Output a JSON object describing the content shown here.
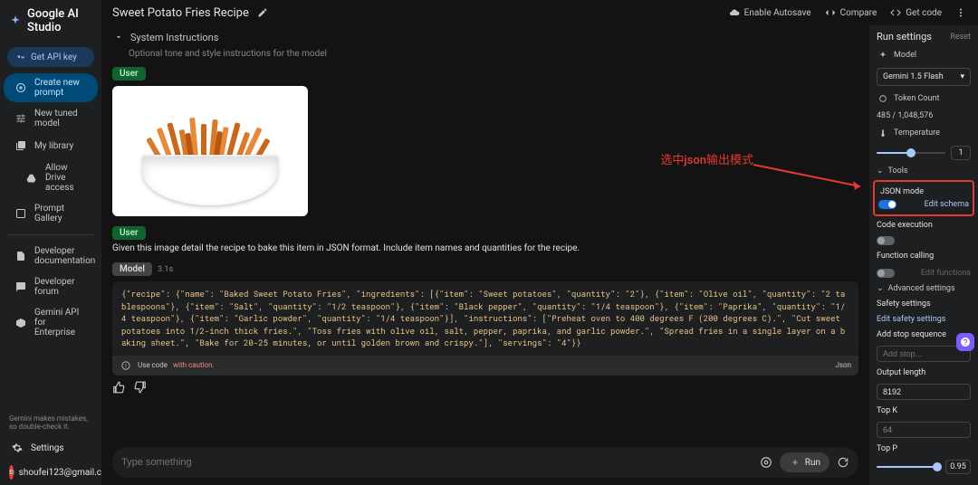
{
  "logo": "Google AI Studio",
  "api_btn": "Get API key",
  "nav": {
    "new_prompt": "Create new prompt",
    "new_tuned": "New tuned model",
    "my_library": "My library",
    "drive": "Allow Drive access",
    "gallery": "Prompt Gallery",
    "docs": "Developer documentation",
    "forum": "Developer forum",
    "enterprise": "Gemini API for Enterprise"
  },
  "disclaimer": "Gemini makes mistakes, so double-check it.",
  "settings_label": "Settings",
  "user_email": "shoufei123@gmail.com",
  "title": "Sweet Potato Fries Recipe",
  "top": {
    "autosave": "Enable Autosave",
    "compare": "Compare",
    "getcode": "Get code"
  },
  "sysinst": {
    "label": "System Instructions",
    "hint": "Optional tone and style instructions for the model"
  },
  "roles": {
    "user": "User",
    "model": "Model"
  },
  "user_prompt": "Given this image detail the recipe to bake this item in JSON format. Include item names and quantities for the recipe.",
  "model_time": "3.1s",
  "code_output": "{\"recipe\": {\"name\": \"Baked Sweet Potato Fries\", \"ingredients\": [{\"item\": \"Sweet potatoes\", \"quantity\": \"2\"}, {\"item\": \"Olive oil\", \"quantity\": \"2 tablespoons\"}, {\"item\": \"Salt\", \"quantity\": \"1/2 teaspoon\"}, {\"item\": \"Black pepper\", \"quantity\": \"1/4 teaspoon\"}, {\"item\": \"Paprika\", \"quantity\": \"1/4 teaspoon\"}, {\"item\": \"Garlic powder\", \"quantity\": \"1/4 teaspoon\"}], \"instructions\": [\"Preheat oven to 400 degrees F (200 degrees C).\", \"Cut sweet potatoes into 1/2-inch thick fries.\", \"Toss fries with olive oil, salt, pepper, paprika, and garlic powder.\", \"Spread fries in a single layer on a baking sheet.\", \"Bake for 20-25 minutes, or until golden brown and crispy.\"], \"servings\": \"4\"}}",
  "code_footer_pre": "Use code",
  "code_footer_caution": "with caution.",
  "code_footer_tag": "Json",
  "input_placeholder": "Type something",
  "run_label": "Run",
  "annotation": "选中json输出模式",
  "rp": {
    "header": "Run settings",
    "reset": "Reset",
    "model_label": "Model",
    "model_value": "Gemini 1.5 Flash",
    "token_label": "Token Count",
    "token_value": "485 / 1,048,576",
    "temp_label": "Temperature",
    "temp_value": "1",
    "tools_label": "Tools",
    "json_mode": "JSON mode",
    "edit_schema": "Edit schema",
    "code_exec": "Code execution",
    "func_call": "Function calling",
    "edit_funcs": "Edit functions",
    "adv_label": "Advanced settings",
    "safety_label": "Safety settings",
    "edit_safety": "Edit safety settings",
    "stop_label": "Add stop sequence",
    "stop_placeholder": "Add stop...",
    "outlen_label": "Output length",
    "outlen_value": "8192",
    "topk_label": "Top K",
    "topk_value": "64",
    "topp_label": "Top P",
    "topp_value": "0.95"
  }
}
